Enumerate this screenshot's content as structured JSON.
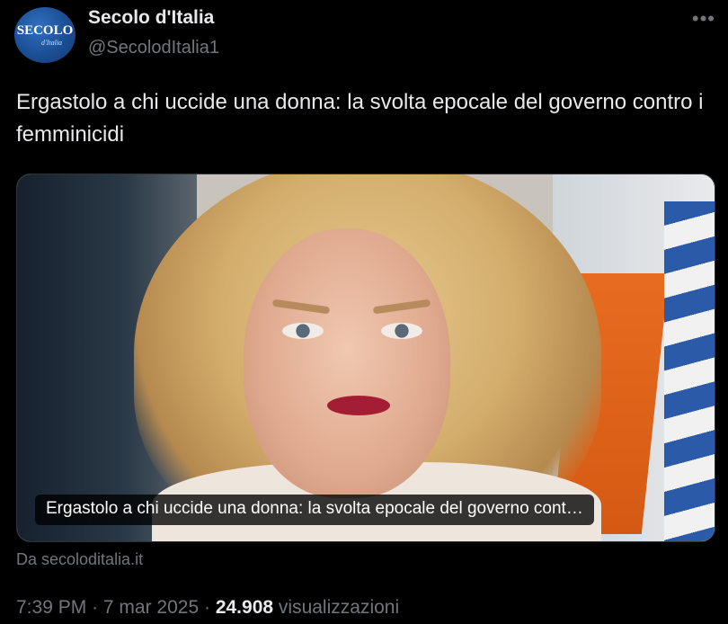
{
  "author": {
    "name": "Secolo d'Italia",
    "handle": "@SecolodItalia1",
    "avatar_text": "SECOLO",
    "avatar_subtext": "d'Italia"
  },
  "more_icon": "more-horizontal-icon",
  "tweet": {
    "text": "Ergastolo a chi uccide una donna: la svolta epocale del governo contro i femminicidi"
  },
  "card": {
    "image_caption": "Ergastolo a chi uccide una donna: la svolta epocale del governo cont…",
    "source": "Da secoloditalia.it"
  },
  "meta": {
    "time": "7:39 PM",
    "separator": "·",
    "date": "7 mar 2025",
    "views_count": "24.908",
    "views_label": "visualizzazioni"
  },
  "colors": {
    "background": "#000000",
    "text_primary": "#e7e9ea",
    "text_secondary": "#71767b",
    "avatar_blue": "#1b4f94"
  }
}
